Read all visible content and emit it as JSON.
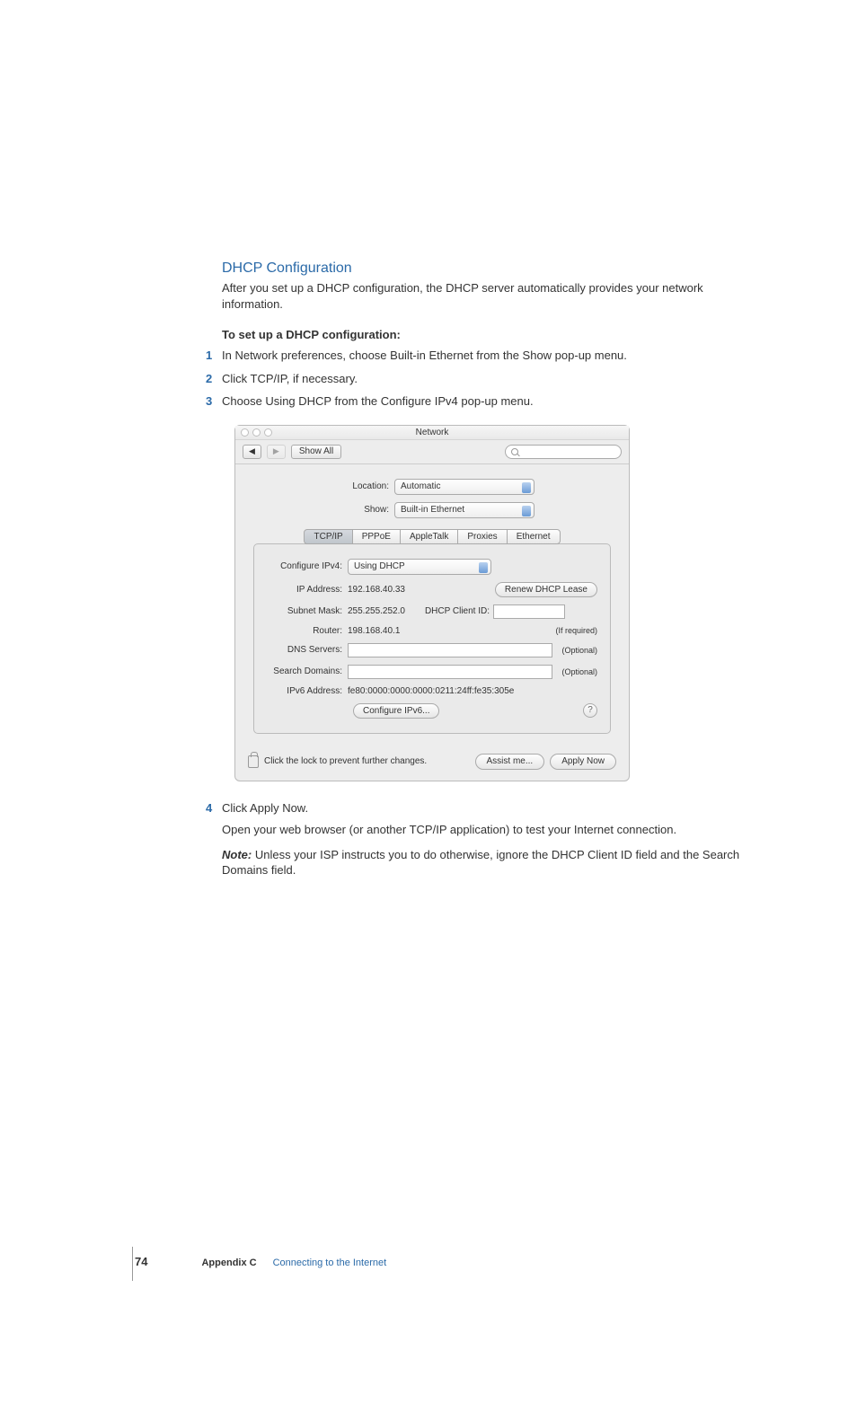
{
  "heading": "DHCP Configuration",
  "intro": "After you set up a DHCP configuration, the DHCP server automatically provides your network information.",
  "sub_heading": "To set up a DHCP configuration:",
  "steps": {
    "s1": {
      "num": "1",
      "text": "In Network preferences, choose Built-in Ethernet from the Show pop-up menu."
    },
    "s2": {
      "num": "2",
      "text": "Click TCP/IP, if necessary."
    },
    "s3": {
      "num": "3",
      "text": "Choose Using DHCP from the Configure IPv4 pop-up menu."
    },
    "s4": {
      "num": "4",
      "text": "Click Apply Now."
    }
  },
  "screenshot": {
    "window_title": "Network",
    "show_all": "Show All",
    "location_label": "Location:",
    "location_value": "Automatic",
    "show_label": "Show:",
    "show_value": "Built-in Ethernet",
    "tabs": {
      "t1": "TCP/IP",
      "t2": "PPPoE",
      "t3": "AppleTalk",
      "t4": "Proxies",
      "t5": "Ethernet"
    },
    "configure_ipv4_label": "Configure IPv4:",
    "configure_ipv4_value": "Using DHCP",
    "ip_label": "IP Address:",
    "ip_value": "192.168.40.33",
    "renew_label": "Renew DHCP Lease",
    "subnet_label": "Subnet Mask:",
    "subnet_value": "255.255.252.0",
    "dhcp_client_label": "DHCP Client ID:",
    "if_required": "(If required)",
    "router_label": "Router:",
    "router_value": "198.168.40.1",
    "dns_label": "DNS Servers:",
    "optional": "(Optional)",
    "search_domains_label": "Search Domains:",
    "ipv6_label": "IPv6 Address:",
    "ipv6_value": "fe80:0000:0000:0000:0211:24ff:fe35:305e",
    "configure_ipv6_btn": "Configure IPv6...",
    "help": "?",
    "lock_text": "Click the lock to prevent further changes.",
    "assist_btn": "Assist me...",
    "apply_btn": "Apply Now"
  },
  "post": {
    "p1": "Open your web browser (or another TCP/IP application) to test your Internet connection.",
    "note_label": "Note:",
    "p2": " Unless your ISP instructs you to do otherwise, ignore the DHCP Client ID field and the Search Domains field."
  },
  "footer": {
    "page": "74",
    "appendix_label": "Appendix C",
    "appendix_title": "Connecting to the Internet"
  }
}
